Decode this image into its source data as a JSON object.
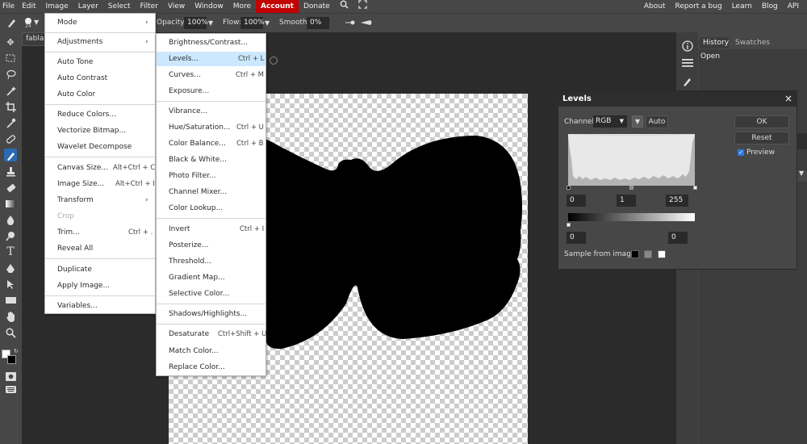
{
  "menubar": {
    "items": [
      "File",
      "Edit",
      "Image",
      "Layer",
      "Select",
      "Filter",
      "View",
      "Window",
      "More",
      "Account",
      "Donate"
    ],
    "right": [
      "About",
      "Report a bug",
      "Learn",
      "Blog",
      "API"
    ]
  },
  "options": {
    "opacity_label": "Opacity:",
    "opacity_value": "100%",
    "flow_label": "Flow:",
    "flow_value": "100%",
    "smooth_label": "Smooth:",
    "smooth_value": "0%",
    "brush_size": "24"
  },
  "document": {
    "tab_label": "fablab"
  },
  "image_menu": [
    {
      "label": "Mode",
      "submenu": true
    },
    {
      "label": "Adjustments",
      "submenu": true
    },
    {
      "label": "Auto Tone"
    },
    {
      "label": "Auto Contrast"
    },
    {
      "label": "Auto Color"
    },
    {
      "label": "Reduce Colors..."
    },
    {
      "label": "Vectorize Bitmap..."
    },
    {
      "label": "Wavelet Decompose"
    },
    {
      "label": "Canvas Size...",
      "shortcut": "Alt+Ctrl + C"
    },
    {
      "label": "Image Size...",
      "shortcut": "Alt+Ctrl + I"
    },
    {
      "label": "Transform",
      "submenu": true
    },
    {
      "label": "Crop",
      "disabled": true
    },
    {
      "label": "Trim...",
      "shortcut": "Ctrl + ."
    },
    {
      "label": "Reveal All"
    },
    {
      "label": "Duplicate"
    },
    {
      "label": "Apply Image..."
    },
    {
      "label": "Variables..."
    }
  ],
  "adjustments_menu": [
    {
      "label": "Brightness/Contrast..."
    },
    {
      "label": "Levels...",
      "shortcut": "Ctrl + L",
      "highlight": true
    },
    {
      "label": "Curves...",
      "shortcut": "Ctrl + M"
    },
    {
      "label": "Exposure..."
    },
    {
      "label": "Vibrance..."
    },
    {
      "label": "Hue/Saturation...",
      "shortcut": "Ctrl + U"
    },
    {
      "label": "Color Balance...",
      "shortcut": "Ctrl + B"
    },
    {
      "label": "Black & White..."
    },
    {
      "label": "Photo Filter..."
    },
    {
      "label": "Channel Mixer..."
    },
    {
      "label": "Color Lookup..."
    },
    {
      "label": "Invert",
      "shortcut": "Ctrl + I"
    },
    {
      "label": "Posterize..."
    },
    {
      "label": "Threshold..."
    },
    {
      "label": "Gradient Map..."
    },
    {
      "label": "Selective Color..."
    },
    {
      "label": "Shadows/Highlights..."
    },
    {
      "label": "Desaturate",
      "shortcut": "Ctrl+Shift + U"
    },
    {
      "label": "Match Color..."
    },
    {
      "label": "Replace Color..."
    }
  ],
  "levels": {
    "title": "Levels",
    "channel_label": "Channel:",
    "channel_value": "RGB",
    "auto_label": "Auto",
    "input_black": "0",
    "input_gamma": "1",
    "input_white": "255",
    "output_black": "0",
    "output_white": "0",
    "sample_label": "Sample from image:",
    "ok_label": "OK",
    "reset_label": "Reset",
    "preview_label": "Preview",
    "preview_checked": true
  },
  "panels": {
    "tabs": [
      "History",
      "Swatches"
    ],
    "history_items": [
      "Open"
    ]
  }
}
